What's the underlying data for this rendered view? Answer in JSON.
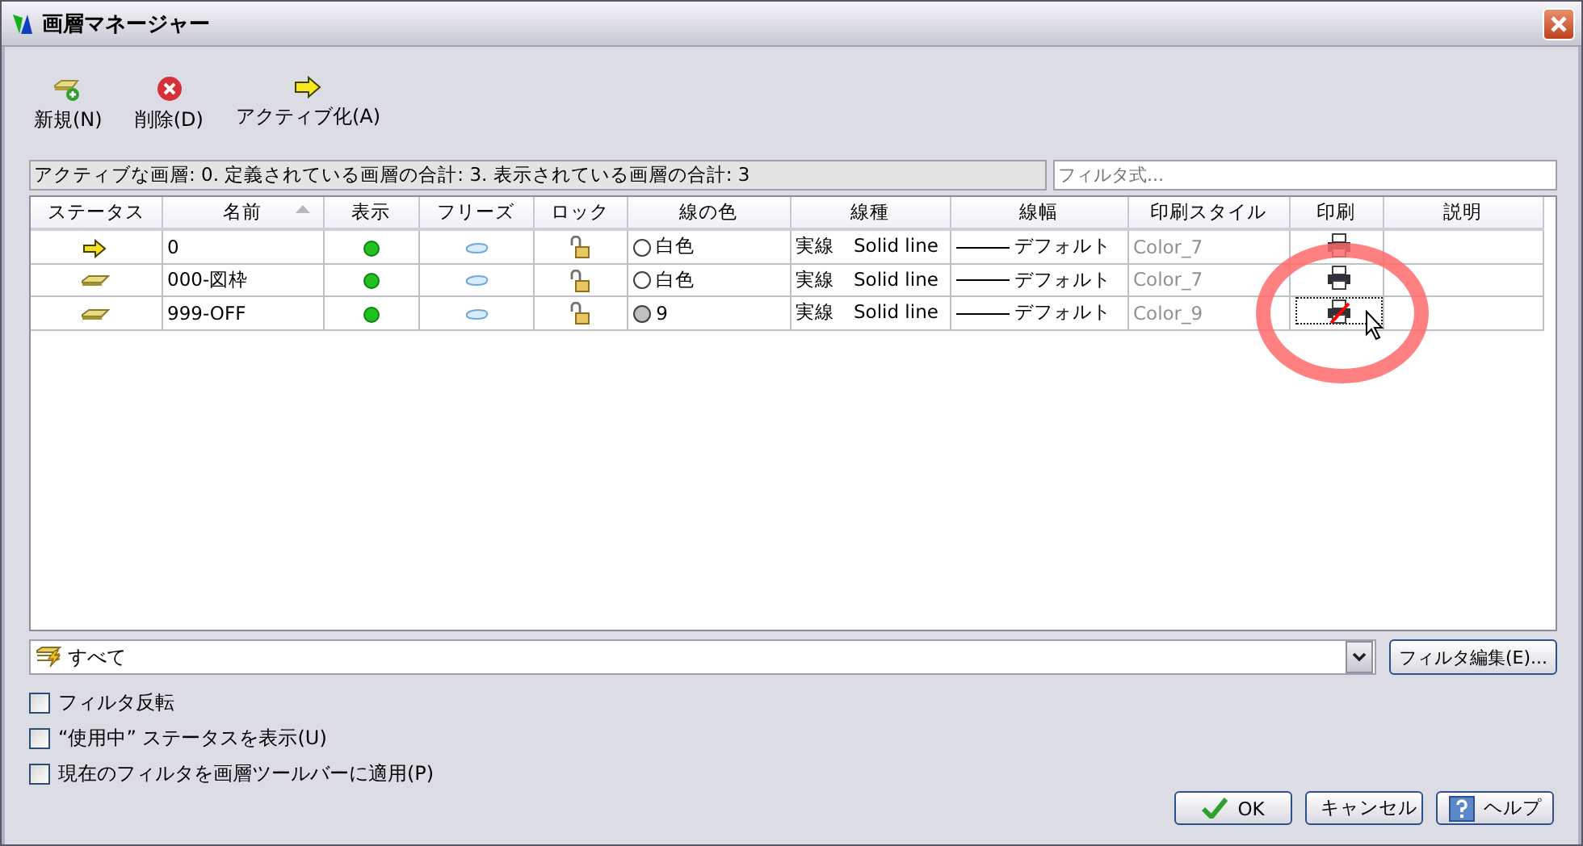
{
  "window": {
    "title": "画層マネージャー"
  },
  "toolbar": [
    {
      "kind": "new",
      "label": "新規(N)"
    },
    {
      "kind": "delete",
      "label": "削除(D)"
    },
    {
      "kind": "activate",
      "label": "アクティブ化(A)"
    }
  ],
  "summary": "アクティブな画層: 0. 定義されている画層の合計: 3. 表示されている画層の合計: 3",
  "filter_search": {
    "placeholder": "フィルタ式..."
  },
  "table": {
    "columns": [
      {
        "label": "ステータス",
        "sorted": false
      },
      {
        "label": "名前",
        "sorted": true
      },
      {
        "label": "表示",
        "sorted": false
      },
      {
        "label": "フリーズ",
        "sorted": false
      },
      {
        "label": "ロック",
        "sorted": false
      },
      {
        "label": "線の色",
        "sorted": false
      },
      {
        "label": "線種",
        "sorted": false
      },
      {
        "label": "線幅",
        "sorted": false
      },
      {
        "label": "印刷スタイル",
        "sorted": false
      },
      {
        "label": "印刷",
        "sorted": false
      },
      {
        "label": "説明",
        "sorted": false
      }
    ],
    "rows": [
      {
        "kind": "current",
        "name": "0",
        "on": true,
        "frozen": false,
        "locked": false,
        "color": "#ffffff",
        "color_name": "白色",
        "linetype": "実線",
        "linetype_desc": "Solid line",
        "lineweight": "デフォルト",
        "plot_style": "Color_7",
        "plot": true,
        "focused": false
      },
      {
        "kind": "layer",
        "name": "000-図枠",
        "on": true,
        "frozen": false,
        "locked": false,
        "color": "#ffffff",
        "color_name": "白色",
        "linetype": "実線",
        "linetype_desc": "Solid line",
        "lineweight": "デフォルト",
        "plot_style": "Color_7",
        "plot": true,
        "focused": false
      },
      {
        "kind": "layer",
        "name": "999-OFF",
        "on": true,
        "frozen": false,
        "locked": false,
        "color": "#c0c0c0",
        "color_name": "9",
        "linetype": "実線",
        "linetype_desc": "Solid line",
        "lineweight": "デフォルト",
        "plot_style": "Color_9",
        "plot": false,
        "focused": true
      }
    ]
  },
  "layer_filter": {
    "value": "すべて"
  },
  "filter_edit_button": "フィルタ編集(E)...",
  "options": [
    {
      "label": "フィルタ反転",
      "checked": false
    },
    {
      "label": "“使用中” ステータスを表示(U)",
      "checked": false
    },
    {
      "label": "現在のフィルタを画層ツールバーに適用(P)",
      "checked": false
    }
  ],
  "buttons": [
    {
      "kind": "ok",
      "label": "OK"
    },
    {
      "kind": "cancel",
      "label": "キャンセル"
    },
    {
      "kind": "help",
      "label": "ヘルプ"
    }
  ]
}
